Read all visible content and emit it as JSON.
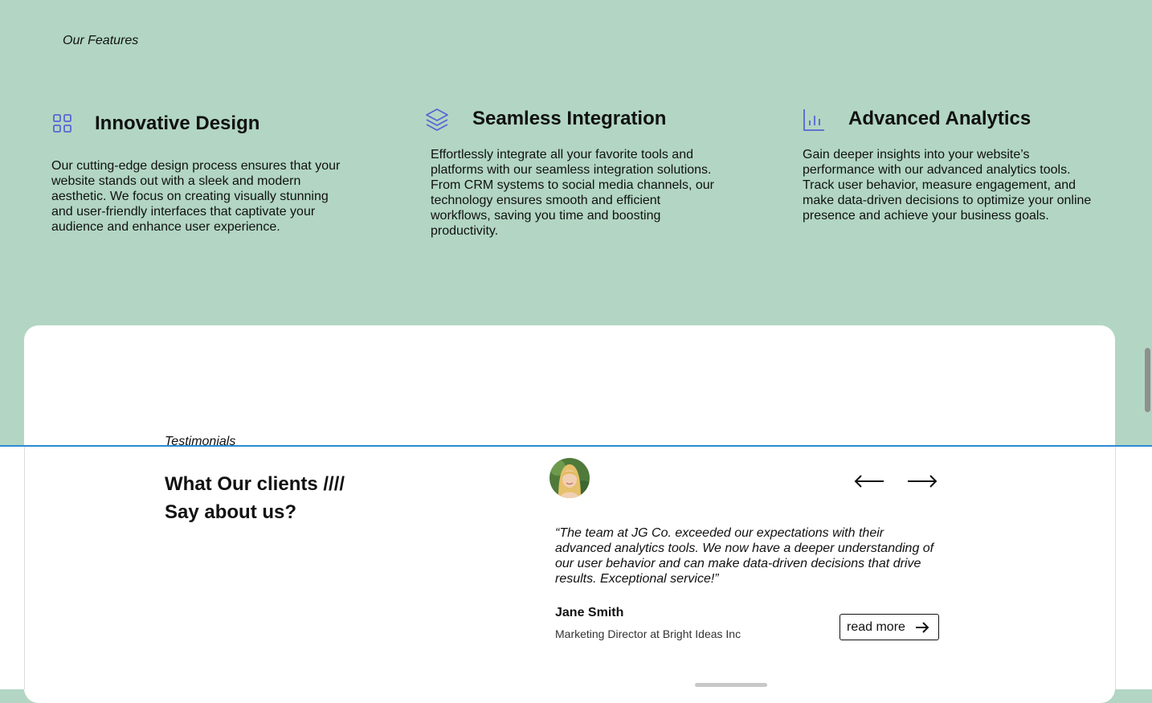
{
  "features_section": {
    "eyebrow": "Our Features",
    "items": [
      {
        "icon": "grid-icon",
        "title": "Innovative Design",
        "body": "Our cutting-edge design process ensures that your website stands out with a sleek and modern aesthetic. We focus on creating visually stunning and user-friendly interfaces that captivate your audience and enhance user experience."
      },
      {
        "icon": "layers-icon",
        "title": "Seamless Integration",
        "body": "Effortlessly integrate all your favorite tools and platforms with our seamless integration solutions. From CRM systems to social media channels, our technology ensures smooth and efficient workflows, saving you time and boosting productivity."
      },
      {
        "icon": "bar-chart-icon",
        "title": "Advanced Analytics",
        "body": "Gain deeper insights into your website’s performance with our advanced analytics tools. Track user behavior, measure engagement, and make data-driven decisions to optimize your online presence and achieve your business goals."
      }
    ]
  },
  "testimonials": {
    "eyebrow": "Testimonials",
    "title": "What Our clients //// Say about us?",
    "quote": "“The team at JG Co. exceeded our expectations with their advanced analytics tools. We now have a deeper understanding of our user behavior and can make data-driven decisions that drive results. Exceptional service!”",
    "author": "Jane Smith",
    "role": "Marketing Director at Bright Ideas Inc",
    "read_more_label": "read more"
  },
  "colors": {
    "background": "#b2d6c3",
    "icon_accent": "#5b63d3",
    "divider_line": "#2c8bd3"
  }
}
